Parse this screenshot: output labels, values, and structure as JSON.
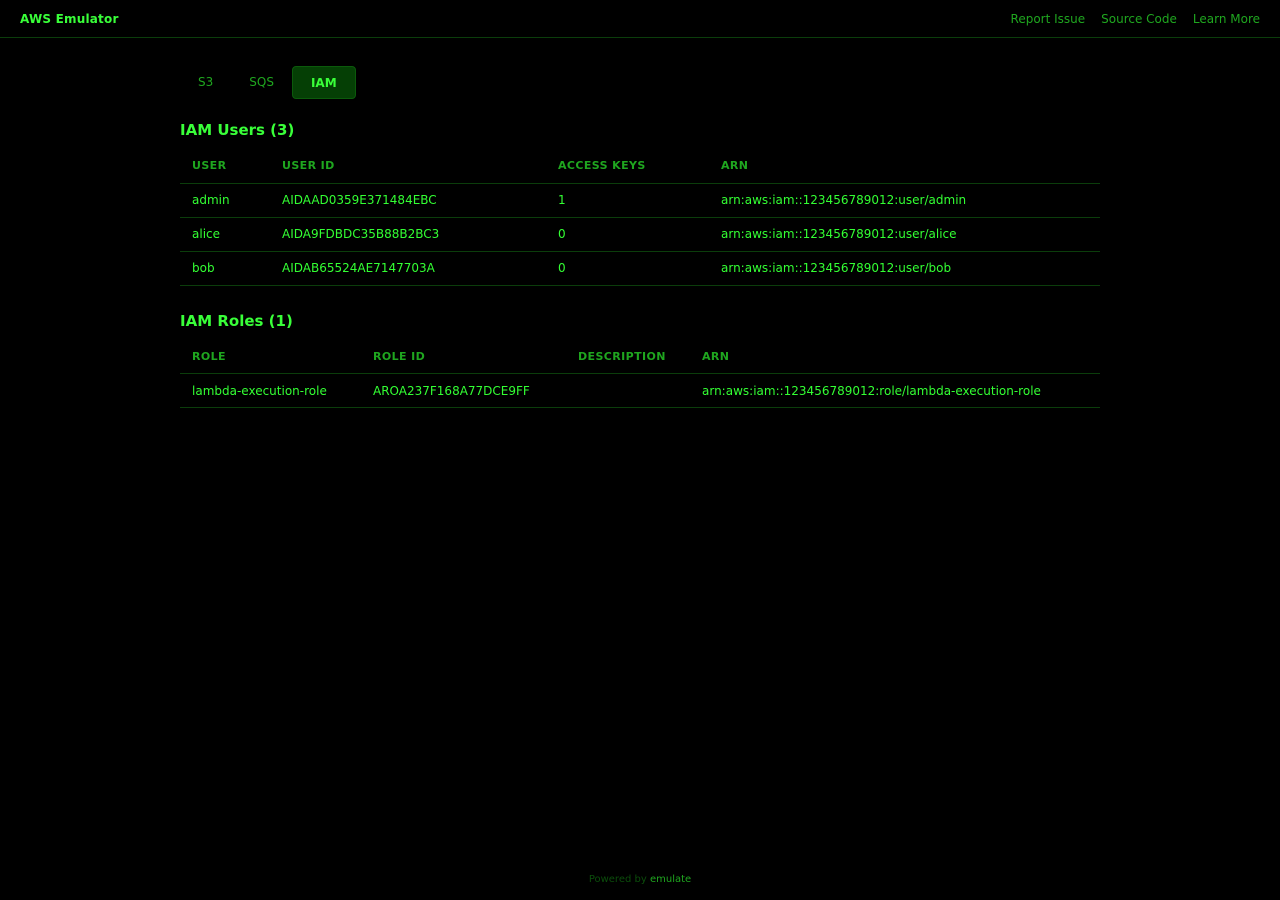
{
  "header": {
    "title": "AWS Emulator",
    "links": [
      "Report Issue",
      "Source Code",
      "Learn More"
    ]
  },
  "tabs": [
    {
      "label": "S3",
      "active": false
    },
    {
      "label": "SQS",
      "active": false
    },
    {
      "label": "IAM",
      "active": true
    }
  ],
  "users": {
    "title": "IAM Users (3)",
    "columns": [
      "USER",
      "USER ID",
      "ACCESS KEYS",
      "ARN"
    ],
    "rows": [
      [
        "admin",
        "AIDAAD0359E371484EBC",
        "1",
        "arn:aws:iam::123456789012:user/admin"
      ],
      [
        "alice",
        "AIDA9FDBDC35B88B2BC3",
        "0",
        "arn:aws:iam::123456789012:user/alice"
      ],
      [
        "bob",
        "AIDAB65524AE7147703A",
        "0",
        "arn:aws:iam::123456789012:user/bob"
      ]
    ]
  },
  "roles": {
    "title": "IAM Roles (1)",
    "columns": [
      "ROLE",
      "ROLE ID",
      "DESCRIPTION",
      "ARN"
    ],
    "rows": [
      [
        "lambda-execution-role",
        "AROA237F168A77DCE9FF",
        "",
        "arn:aws:iam::123456789012:role/lambda-execution-role"
      ]
    ]
  },
  "footer": {
    "prefix": "Powered by",
    "link": "emulate"
  }
}
